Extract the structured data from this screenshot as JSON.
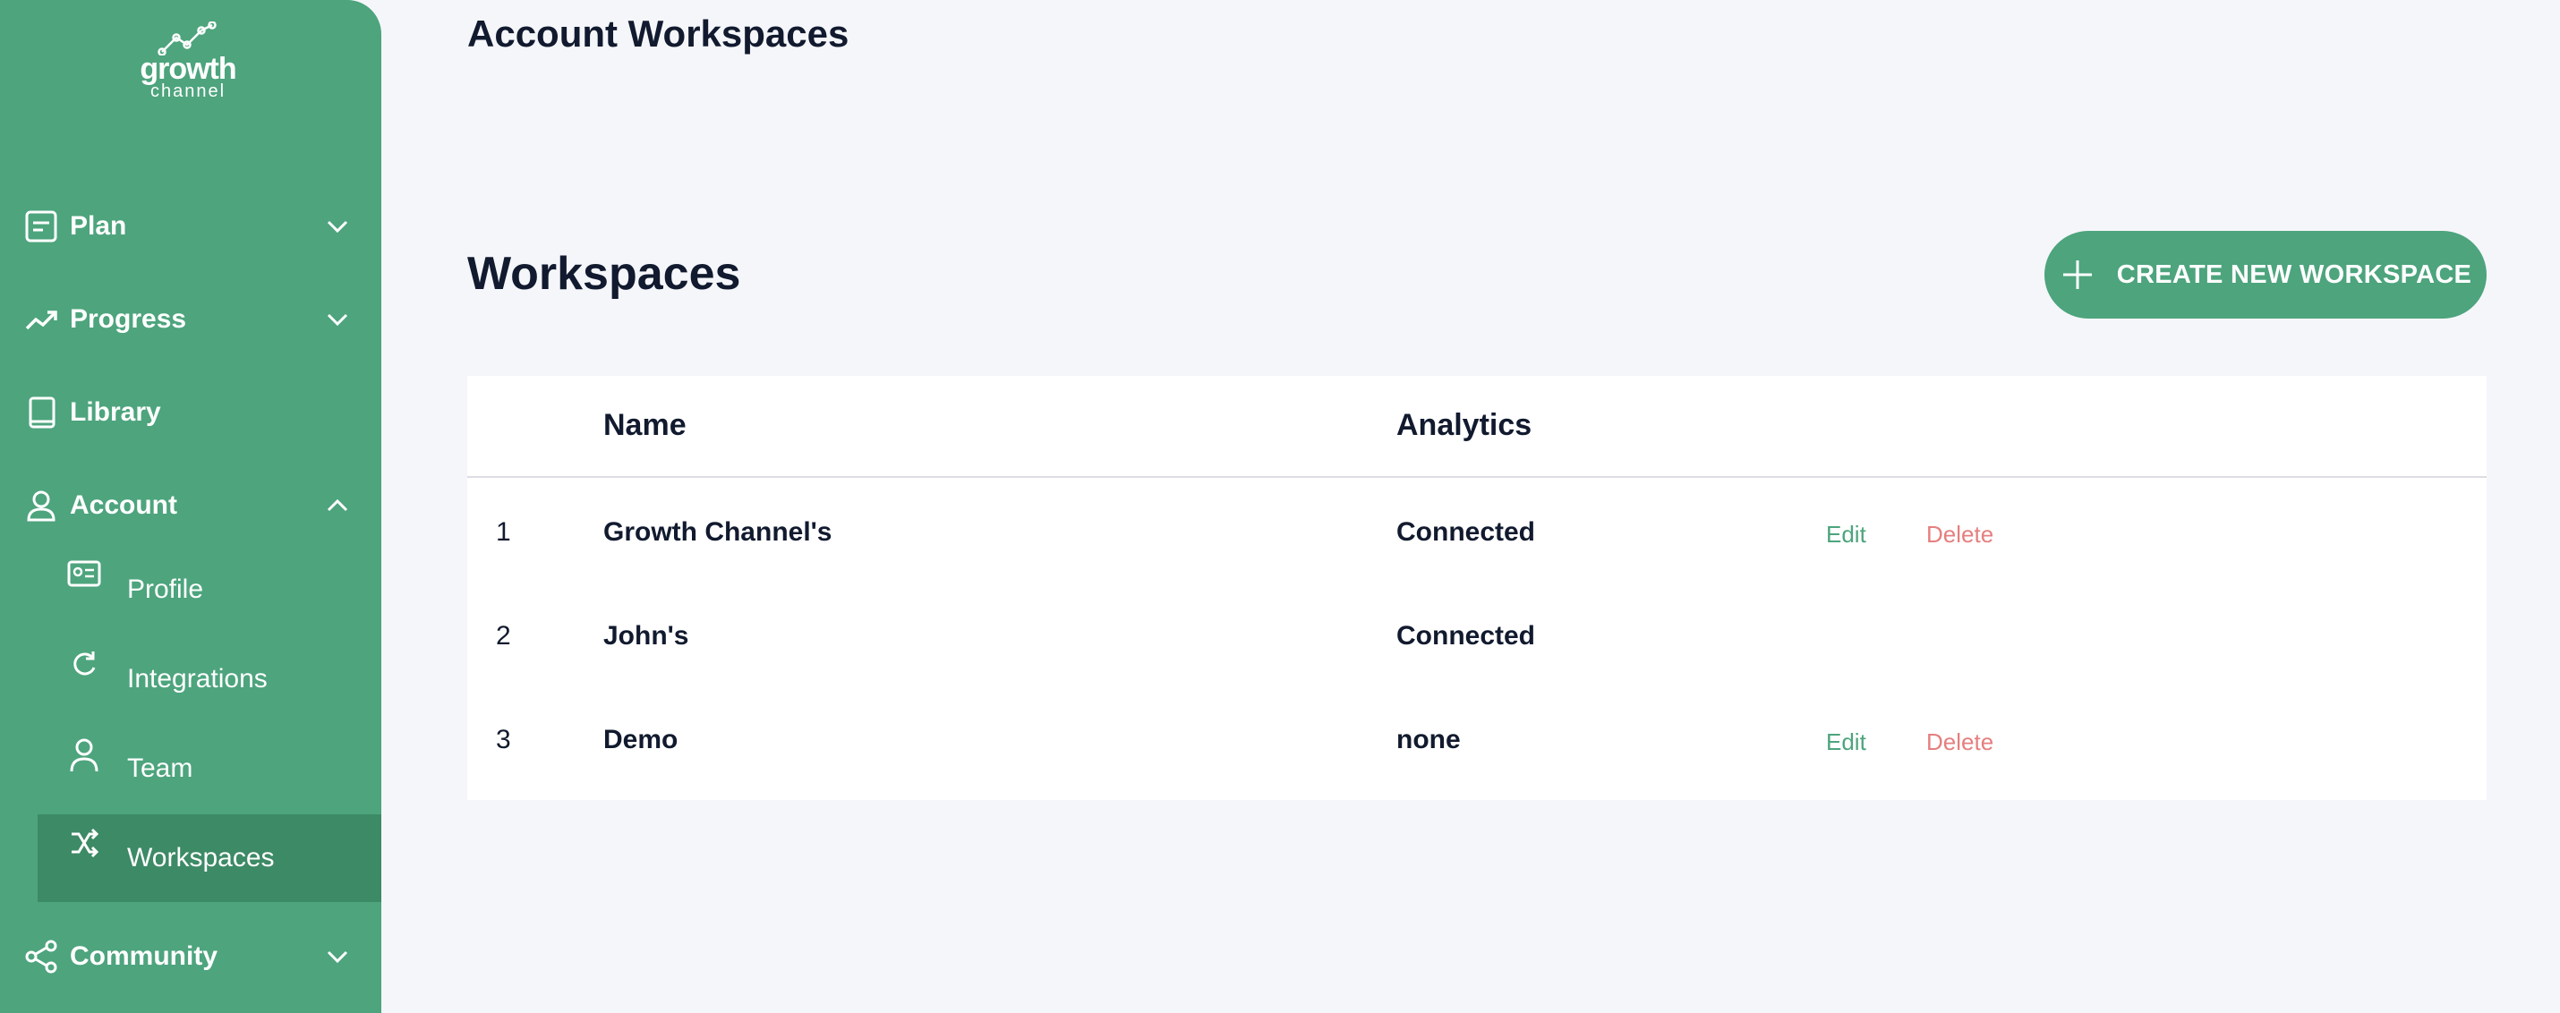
{
  "brand": {
    "name": "growth",
    "sub": "channel",
    "accent": "#4da47d"
  },
  "sidebar": {
    "items": [
      {
        "label": "Plan",
        "icon": "notepad-icon",
        "expanded": false
      },
      {
        "label": "Progress",
        "icon": "trend-up-icon",
        "expanded": false
      },
      {
        "label": "Library",
        "icon": "book-icon"
      },
      {
        "label": "Account",
        "icon": "user-icon",
        "expanded": true
      },
      {
        "label": "Community",
        "icon": "share-icon",
        "expanded": false
      }
    ],
    "account_subitems": [
      {
        "label": "Profile",
        "icon": "id-card-icon"
      },
      {
        "label": "Integrations",
        "icon": "refresh-icon"
      },
      {
        "label": "Team",
        "icon": "person-icon"
      },
      {
        "label": "Workspaces",
        "icon": "shuffle-icon",
        "active": true
      }
    ]
  },
  "header": {
    "title": "Account Workspaces"
  },
  "main": {
    "section_title": "Workspaces",
    "create_button": "CREATE NEW WORKSPACE",
    "table": {
      "columns": [
        "Name",
        "Analytics"
      ],
      "rows": [
        {
          "index": "1",
          "name": "Growth Channel's",
          "analytics": "Connected",
          "edit": "Edit",
          "delete": "Delete"
        },
        {
          "index": "2",
          "name": "John's",
          "analytics": "Connected"
        },
        {
          "index": "3",
          "name": "Demo",
          "analytics": "none",
          "edit": "Edit",
          "delete": "Delete"
        }
      ]
    }
  }
}
